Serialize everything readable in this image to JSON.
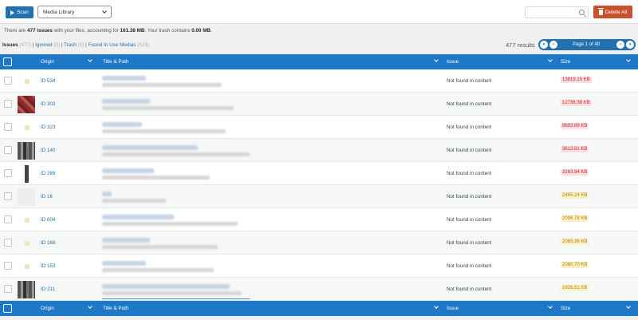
{
  "toolbar": {
    "scan_label": "Scan",
    "media_select": "Media Library",
    "search_placeholder": "",
    "delete_all_label": "Delete All"
  },
  "summary": {
    "prefix": "There are ",
    "issues": "477 issues",
    "middle": " with your files, accounting for ",
    "size": "161.38 MB",
    "suffix": ". Your trash contains ",
    "trash": "0.00 MB",
    "end": "."
  },
  "filters": {
    "issues": "Issues",
    "issues_count": "(477)",
    "ignored": "Ignored",
    "ignored_count": "(0)",
    "trash": "Trash",
    "trash_count": "(0)",
    "found": "Found In Use Medias",
    "found_count": "(523)"
  },
  "pagination": {
    "results": "477 results",
    "page_text": "Page 1 of 48"
  },
  "columns": {
    "origin": "Origin",
    "title_path": "Title & Path",
    "issue": "Issue",
    "size": "Size"
  },
  "rows": [
    {
      "origin": "ID 534",
      "issue": "Not found in content",
      "size": "13819.15 KB",
      "level": "red",
      "thumb": "file"
    },
    {
      "origin": "ID 303",
      "issue": "Not found in content",
      "size": "12736.38 KB",
      "level": "red",
      "thumb": "red"
    },
    {
      "origin": "ID 323",
      "issue": "Not found in content",
      "size": "8693.89 KB",
      "level": "red",
      "thumb": "file"
    },
    {
      "origin": "ID 140",
      "issue": "Not found in content",
      "size": "3613.81 KB",
      "level": "red",
      "thumb": "gray"
    },
    {
      "origin": "ID 286",
      "issue": "Not found in content",
      "size": "3163.94 KB",
      "level": "red",
      "thumb": "mid"
    },
    {
      "origin": "ID 16",
      "issue": "Not found in content",
      "size": "2465.24 KB",
      "level": "yellow",
      "thumb": "light"
    },
    {
      "origin": "ID 604",
      "issue": "Not found in content",
      "size": "2096.78 KB",
      "level": "yellow",
      "thumb": "file"
    },
    {
      "origin": "ID 168",
      "issue": "Not found in content",
      "size": "2085.36 KB",
      "level": "yellow",
      "thumb": "file"
    },
    {
      "origin": "ID 153",
      "issue": "Not found in content",
      "size": "2080.70 KB",
      "level": "yellow",
      "thumb": "file"
    },
    {
      "origin": "ID 211",
      "issue": "Not found in content",
      "size": "1926.51 KB",
      "level": "yellow",
      "thumb": "gray"
    }
  ],
  "colors": {
    "primary": "#2271b1",
    "header": "#1e78c8",
    "danger": "#c9502c"
  }
}
